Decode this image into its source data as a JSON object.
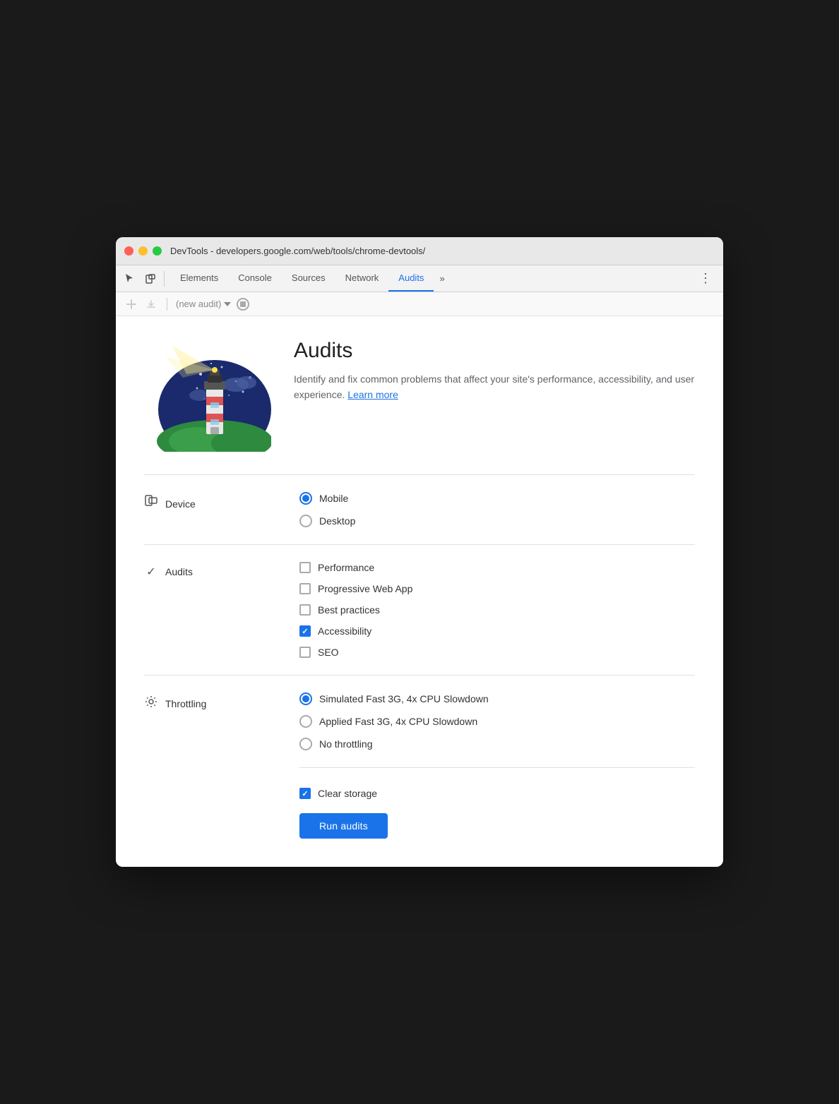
{
  "window": {
    "title": "DevTools - developers.google.com/web/tools/chrome-devtools/"
  },
  "nav": {
    "tabs": [
      {
        "id": "elements",
        "label": "Elements",
        "active": false
      },
      {
        "id": "console",
        "label": "Console",
        "active": false
      },
      {
        "id": "sources",
        "label": "Sources",
        "active": false
      },
      {
        "id": "network",
        "label": "Network",
        "active": false
      },
      {
        "id": "audits",
        "label": "Audits",
        "active": true
      }
    ],
    "more_label": "»",
    "dots_label": "⋮"
  },
  "toolbar": {
    "new_audit_placeholder": "(new audit)",
    "stop_title": "Stop"
  },
  "hero": {
    "title": "Audits",
    "description": "Identify and fix common problems that affect your site's performance, accessibility, and user experience.",
    "learn_more": "Learn more"
  },
  "device_section": {
    "label": "Device",
    "options": [
      {
        "id": "mobile",
        "label": "Mobile",
        "checked": true
      },
      {
        "id": "desktop",
        "label": "Desktop",
        "checked": false
      }
    ]
  },
  "audits_section": {
    "label": "Audits",
    "options": [
      {
        "id": "performance",
        "label": "Performance",
        "checked": false
      },
      {
        "id": "pwa",
        "label": "Progressive Web App",
        "checked": false
      },
      {
        "id": "best-practices",
        "label": "Best practices",
        "checked": false
      },
      {
        "id": "accessibility",
        "label": "Accessibility",
        "checked": true
      },
      {
        "id": "seo",
        "label": "SEO",
        "checked": false
      }
    ]
  },
  "throttling_section": {
    "label": "Throttling",
    "options": [
      {
        "id": "simulated-fast-3g",
        "label": "Simulated Fast 3G, 4x CPU Slowdown",
        "checked": true
      },
      {
        "id": "applied-fast-3g",
        "label": "Applied Fast 3G, 4x CPU Slowdown",
        "checked": false
      },
      {
        "id": "no-throttling",
        "label": "No throttling",
        "checked": false
      }
    ]
  },
  "clear_storage": {
    "label": "Clear storage",
    "checked": true
  },
  "run_button": {
    "label": "Run audits"
  }
}
